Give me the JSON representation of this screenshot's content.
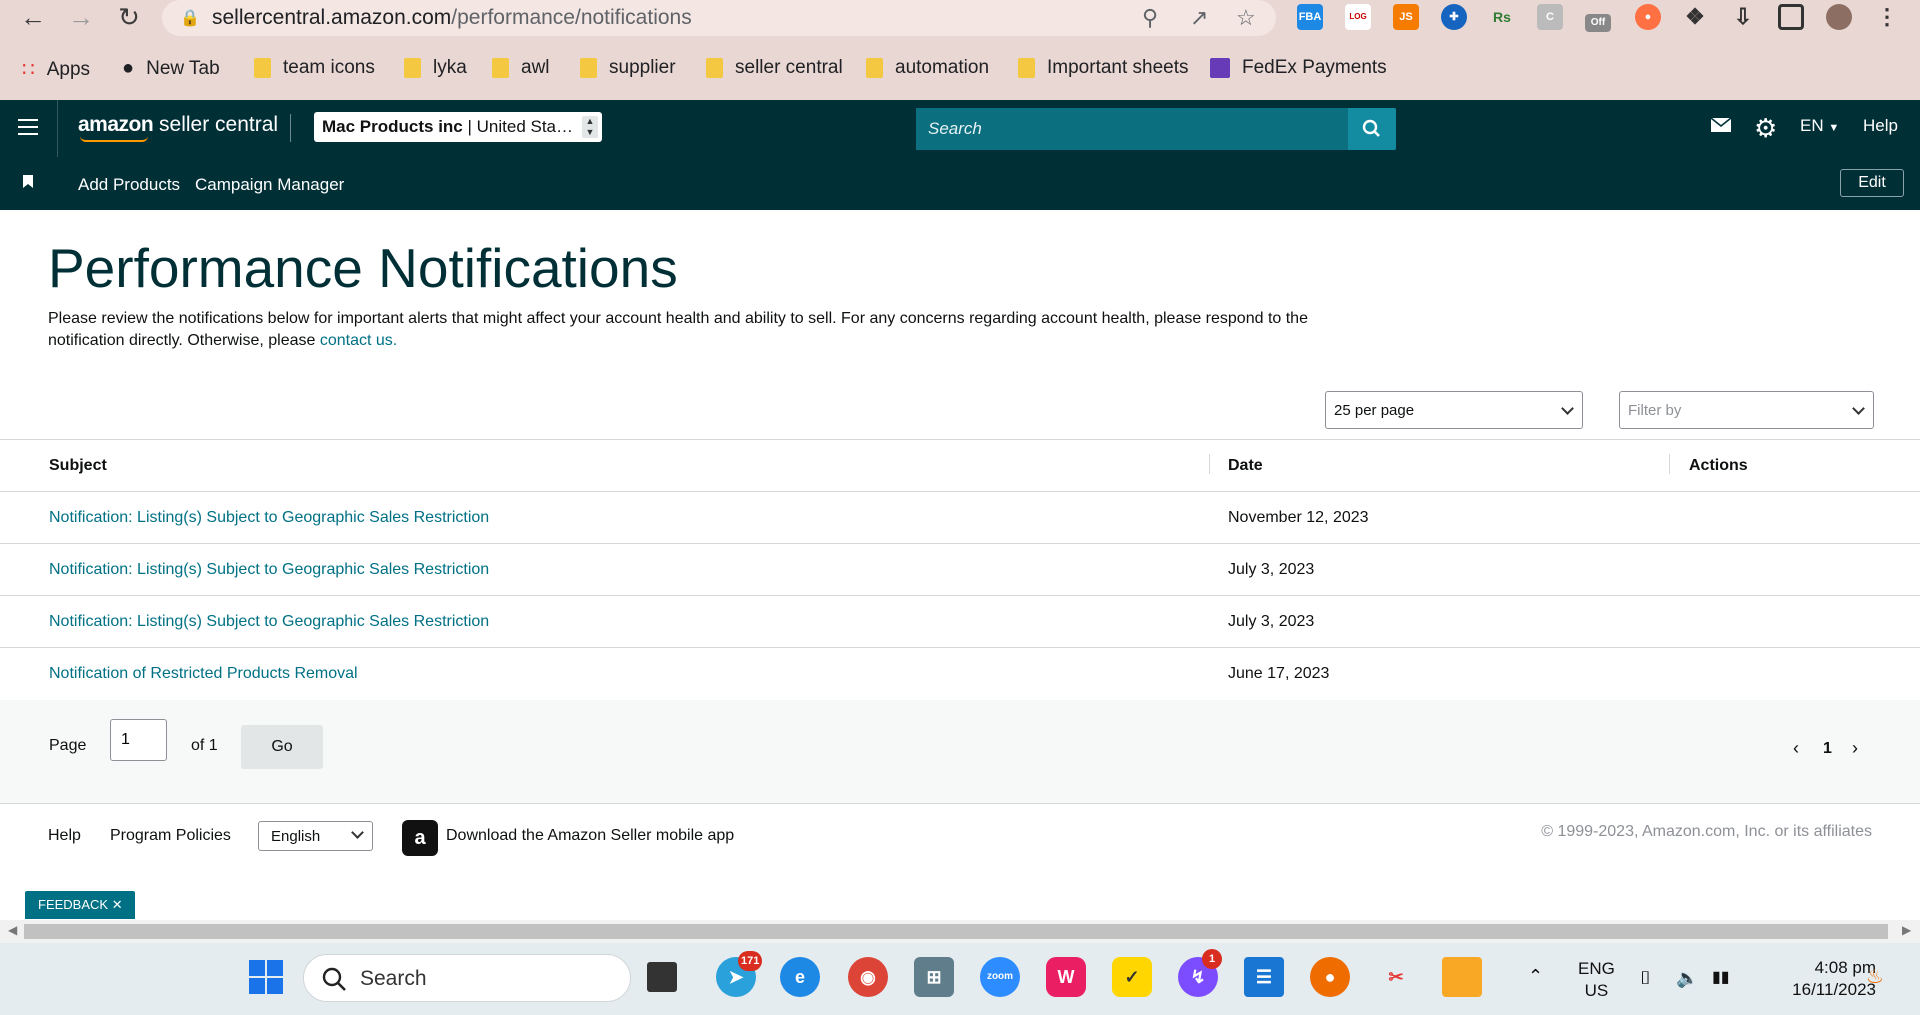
{
  "browser": {
    "url_host": "sellercentral.amazon.com",
    "url_path": "/performance/notifications",
    "bookmarks": [
      "Apps",
      "New Tab",
      "team icons",
      "lyka",
      "awl",
      "supplier",
      "seller central",
      "automation",
      "Important sheets",
      "FedEx Payments"
    ]
  },
  "header": {
    "logo_brand": "amazon",
    "logo_product": " seller central",
    "account_name": "Mac Products inc",
    "account_region": " | United Sta…",
    "search_placeholder": "Search",
    "language": "EN",
    "help": "Help"
  },
  "subnav": {
    "items": [
      "Add Products",
      "Campaign Manager"
    ],
    "edit": "Edit"
  },
  "page": {
    "title": "Performance Notifications",
    "description": "Please review the notifications below for important alerts that might affect your account health and ability to sell. For any concerns regarding account health, please respond to the notification directly. Otherwise, please ",
    "contact_link": "contact us.",
    "per_page": "25 per page",
    "filter_placeholder": "Filter by"
  },
  "table": {
    "columns": [
      "Subject",
      "Date",
      "Actions"
    ],
    "rows": [
      {
        "subject": "Notification: Listing(s) Subject to Geographic Sales Restriction",
        "date": "November 12, 2023"
      },
      {
        "subject": "Notification: Listing(s) Subject to Geographic Sales Restriction",
        "date": "July 3, 2023"
      },
      {
        "subject": "Notification: Listing(s) Subject to Geographic Sales Restriction",
        "date": "July 3, 2023"
      },
      {
        "subject": "Notification of Restricted Products Removal",
        "date": "June 17, 2023"
      }
    ]
  },
  "pagination": {
    "page_label": "Page",
    "page_value": "1",
    "of_label": "of 1",
    "go": "Go",
    "current": "1"
  },
  "footer": {
    "help": "Help",
    "policies": "Program Policies",
    "language": "English",
    "app_text": "Download the Amazon Seller mobile app",
    "copyright": "© 1999-2023, Amazon.com, Inc. or its affiliates",
    "feedback": "FEEDBACK"
  },
  "taskbar": {
    "search": "Search",
    "lang_top": "ENG",
    "lang_bottom": "US",
    "time": "4:08 pm",
    "date": "16/11/2023",
    "telegram_badge": "171",
    "messenger_badge": "1",
    "ext_badge_off": "Off"
  },
  "colors": {
    "header_bg": "#002f36",
    "link": "#007185",
    "search_bg": "#0b6f80"
  }
}
